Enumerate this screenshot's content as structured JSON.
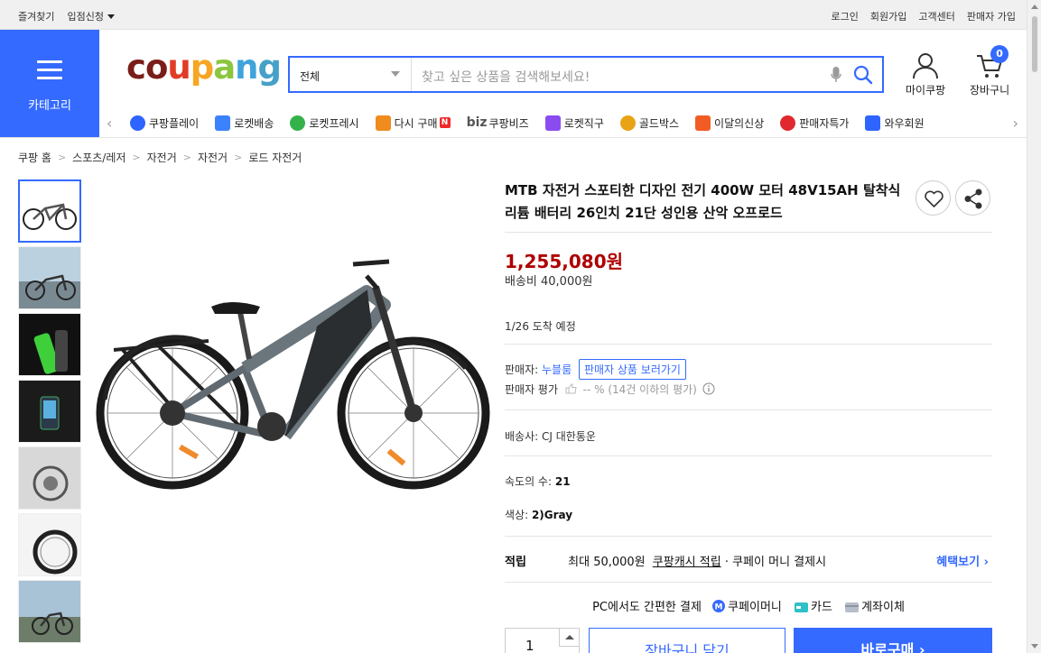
{
  "topbar": {
    "left": [
      "즐겨찾기",
      "입점신청"
    ],
    "right": [
      "로그인",
      "회원가입",
      "고객센터",
      "판매자 가입"
    ]
  },
  "header": {
    "category_label": "카테고리",
    "logo_letters": [
      "c",
      "o",
      "u",
      "p",
      "a",
      "n",
      "g"
    ],
    "search": {
      "category": "전체",
      "placeholder": "찾고 싶은 상품을 검색해보세요!"
    },
    "mypage_label": "마이쿠팡",
    "cart_label": "장바구니",
    "cart_count": "0"
  },
  "nav": [
    {
      "label": "쿠팡플레이",
      "icon": "play-icon",
      "color": "#2e64ff"
    },
    {
      "label": "로켓배송",
      "icon": "rocket-icon",
      "color": "#3c82ff"
    },
    {
      "label": "로켓프레시",
      "icon": "rocket-fresh-icon",
      "color": "#33b24a"
    },
    {
      "label": "다시 구매",
      "icon": "rebuy-icon",
      "color": "#f08b1d",
      "badge": "N"
    },
    {
      "label": "쿠팡비즈",
      "icon": "biz-icon",
      "color": "#555555",
      "prefix": "biz"
    },
    {
      "label": "로켓직구",
      "icon": "global-rocket-icon",
      "color": "#8a4cf0"
    },
    {
      "label": "골드박스",
      "icon": "goldbox-icon",
      "color": "#e8a317"
    },
    {
      "label": "이달의신상",
      "icon": "new-arrival-icon",
      "color": "#f25c24"
    },
    {
      "label": "판매자특가",
      "icon": "seller-deal-icon",
      "color": "#e0282e"
    },
    {
      "label": "와우회원",
      "icon": "wow-icon",
      "color": "#2e64ff"
    }
  ],
  "breadcrumb": [
    "쿠팡 홈",
    "스포츠/레저",
    "자전거",
    "자전거",
    "로드 자전거"
  ],
  "product": {
    "title": "MTB 자전거 스포티한 디자인 전기 400W 모터 48V15AH 탈착식 리튬 배터리 26인치 21단 성인용 산악 오프로드",
    "price": "1,255,080원",
    "shipping_fee": "배송비 40,000원",
    "arrival": "1/26 도착 예정",
    "seller_label": "판매자:",
    "seller_name": "누블룸",
    "seller_products_button": "판매자 상품 보러가기",
    "seller_rating_label": "판매자 평가",
    "seller_rating_value": "-- % (14건 이하의 평가)",
    "courier_label": "배송사:",
    "courier_value": "CJ 대한통운",
    "speed_label": "속도의 수:",
    "speed_value": "21",
    "color_label": "색상:",
    "color_value": "2)Gray"
  },
  "points": {
    "label": "적립",
    "max_text": "최대 50,000원",
    "cash_link": "쿠팡캐시 적립",
    "suffix": "· 쿠페이 머니 결제시",
    "benefit_link": "혜택보기"
  },
  "payment": {
    "lead": "PC에서도 간편한 결제",
    "methods": [
      "쿠페이머니",
      "카드",
      "계좌이체"
    ]
  },
  "purchase": {
    "quantity": "1",
    "cart_button": "장바구니 담기",
    "buy_button": "바로구매"
  },
  "colors": {
    "accent": "#346aff",
    "price": "#ae0000"
  }
}
